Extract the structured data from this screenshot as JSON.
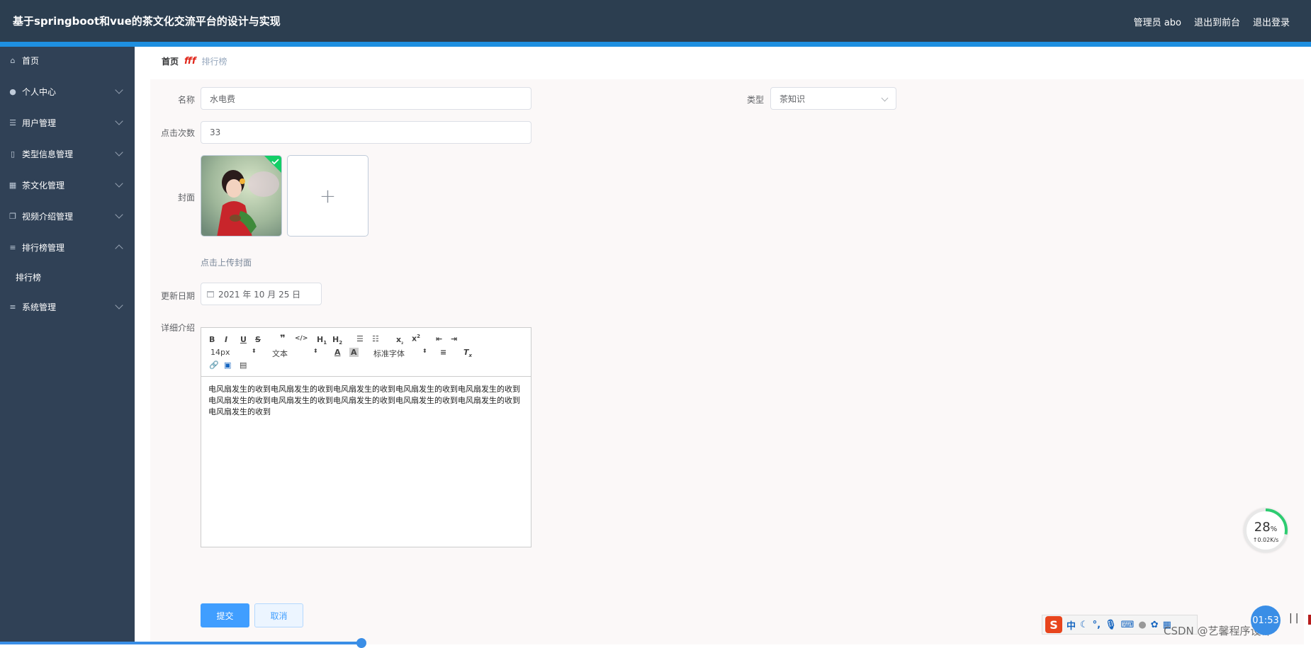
{
  "header": {
    "title": "基于springboot和vue的茶文化交流平台的设计与实现",
    "admin_label": "管理员 abo",
    "front_link": "退出到前台",
    "logout": "退出登录"
  },
  "sidebar": {
    "items": [
      {
        "label": "首页",
        "icon": "home-icon",
        "expandable": false
      },
      {
        "label": "个人中心",
        "icon": "user-icon",
        "expandable": true
      },
      {
        "label": "用户管理",
        "icon": "sliders-icon",
        "expandable": true
      },
      {
        "label": "类型信息管理",
        "icon": "phone-icon",
        "expandable": true
      },
      {
        "label": "茶文化管理",
        "icon": "grid-icon",
        "expandable": true
      },
      {
        "label": "视频介绍管理",
        "icon": "copy-icon",
        "expandable": true
      },
      {
        "label": "排行榜管理",
        "icon": "menu-icon",
        "expandable": true,
        "expanded": true
      },
      {
        "label": "系统管理",
        "icon": "menu-icon",
        "expandable": true
      }
    ],
    "submenu": {
      "label": "排行榜"
    }
  },
  "breadcrumb": {
    "home": "首页",
    "separator": "fff",
    "current": "排行榜"
  },
  "form": {
    "name_label": "名称",
    "name_value": "水电费",
    "type_label": "类型",
    "type_value": "茶知识",
    "clicks_label": "点击次数",
    "clicks_value": "33",
    "cover_label": "封面",
    "cover_hint": "点击上传封面",
    "date_label": "更新日期",
    "date_value": "2021 年 10 月 25 日",
    "detail_label": "详细介绍",
    "editor_content": "电风扇发生的收到电风扇发生的收到电风扇发生的收到电风扇发生的收到电风扇发生的收到电风扇发生的收到电风扇发生的收到电风扇发生的收到电风扇发生的收到电风扇发生的收到电风扇发生的收到",
    "toolbar": {
      "font_size": "14px",
      "header_select": "文本",
      "font_family": "标准字体"
    },
    "submit": "提交",
    "cancel": "取消"
  },
  "widgets": {
    "speed_pct": "28",
    "speed_pct_unit": "%",
    "speed_rate": "↑0.02K/s",
    "clock": "01:53",
    "ime_label": "中",
    "watermark": "CSDN @艺馨程序设计"
  },
  "colors": {
    "header_bg": "#2c3e50",
    "sidebar_bg": "#304156",
    "accent": "#1e8fe0",
    "primary": "#409eff"
  }
}
